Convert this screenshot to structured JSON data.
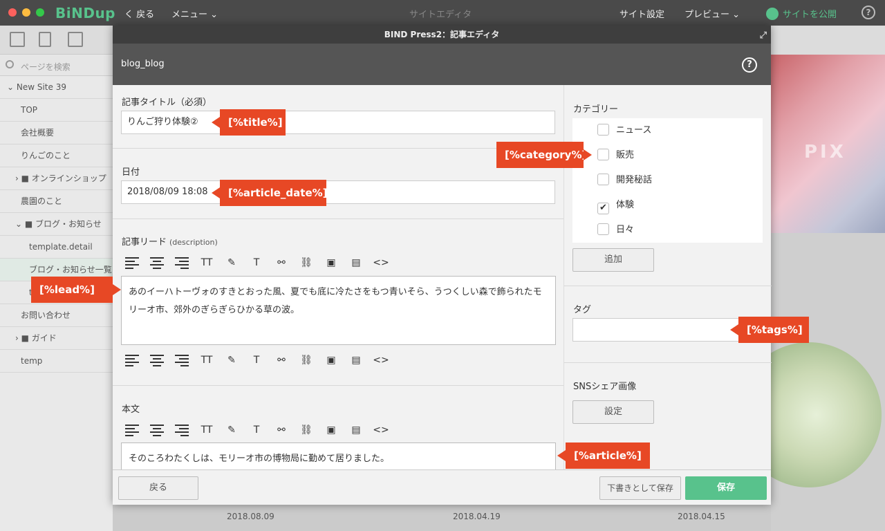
{
  "app": {
    "logo": "BiNDup",
    "back": "く 戻る",
    "menu": "メニュー ⌄",
    "center_title": "サイトエディタ",
    "site_settings": "サイト設定",
    "preview": "プレビュー ⌄",
    "publish": "サイトを公開",
    "help": "?"
  },
  "sidebar": {
    "search_placeholder": "ページを検索",
    "items": [
      {
        "label": "⌄ New Site 39"
      },
      {
        "label": "TOP"
      },
      {
        "label": "会社概要"
      },
      {
        "label": "りんごのこと"
      },
      {
        "label": "› ■ オンラインショップ"
      },
      {
        "label": "農園のこと"
      },
      {
        "label": "⌄ ■ ブログ・お知らせ"
      },
      {
        "label": "template.detail"
      },
      {
        "label": "ブログ・お知らせ一覧"
      },
      {
        "label": "t"
      },
      {
        "label": "お問い合わせ"
      },
      {
        "label": "› ■ ガイド"
      },
      {
        "label": "temp"
      }
    ]
  },
  "background": {
    "dates": [
      "2018.08.09",
      "2018.04.19",
      "2018.04.15"
    ],
    "hero_text": "PIX"
  },
  "modal": {
    "title": "BIND Press2：記事エディタ",
    "blog_name": "blog_blog",
    "help": "?",
    "fields": {
      "title_label": "記事タイトル（必須）",
      "title_value": "りんご狩り体験②",
      "date_label": "日付",
      "date_value": "2018/08/09 18:08",
      "lead_label": "記事リード",
      "lead_sub": "(description)",
      "lead_text": "あのイーハトーヴォのすきとおった風、夏でも底に冷たさをもつ青いそら、うつくしい森で飾られたモリーオ市、郊外のぎらぎらひかる草の波。",
      "body_label": "本文",
      "body_text": "そのころわたくしは、モリーオ市の博物局に勤めて居りました。"
    },
    "toolbar_labels": {
      "font": "TT",
      "tag": "T",
      "code": "<>"
    },
    "category": {
      "label": "カテゴリー",
      "items": [
        {
          "label": "ニュース",
          "checked": ""
        },
        {
          "label": "販売",
          "checked": ""
        },
        {
          "label": "開発秘話",
          "checked": ""
        },
        {
          "label": "体験",
          "checked": "✔"
        },
        {
          "label": "日々",
          "checked": ""
        }
      ],
      "add_button": "追加"
    },
    "tags": {
      "label": "タグ",
      "value": ""
    },
    "sns": {
      "label": "SNSシェア画像",
      "button": "設定"
    },
    "footer": {
      "back": "戻る",
      "draft": "下書きとして保存",
      "save": "保存"
    }
  },
  "callouts": {
    "title": "[%title%]",
    "date": "[%article_date%]",
    "lead": "[%lead%]",
    "category": "[%category%]",
    "tags": "[%tags%]",
    "article": "[%article%]"
  },
  "colors": {
    "accent": "#58c28c",
    "callout": "#e74825",
    "header": "#555555"
  }
}
